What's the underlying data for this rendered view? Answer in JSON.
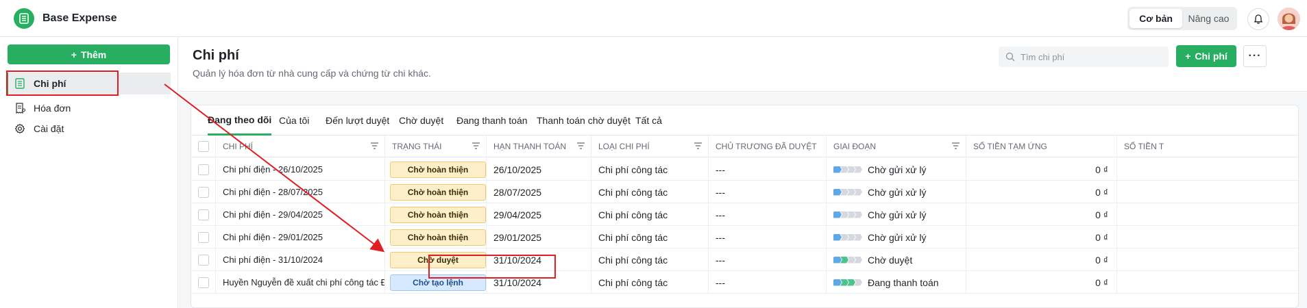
{
  "app": {
    "title": "Base Expense"
  },
  "header": {
    "mode_basic": "Cơ bản",
    "mode_advanced": "Nâng cao"
  },
  "sidebar": {
    "add_label": "Thêm",
    "items": [
      {
        "label": "Chi phí"
      },
      {
        "label": "Hóa đơn"
      },
      {
        "label": "Cài đặt"
      }
    ]
  },
  "page": {
    "title": "Chi phí",
    "subtitle": "Quản lý hóa đơn từ nhà cung cấp và chứng từ chi khác.",
    "search_placeholder": "Tìm chi phí",
    "add_button": "Chi phí",
    "more_button": "···"
  },
  "tabs": [
    {
      "label": "Đang theo dõi"
    },
    {
      "label": "Của tôi"
    },
    {
      "label": "Đến lượt duyệt"
    },
    {
      "label": "Chờ duyệt"
    },
    {
      "label": "Đang thanh toán"
    },
    {
      "label": "Thanh toán chờ duyệt"
    },
    {
      "label": "Tất cả"
    }
  ],
  "columns": {
    "name": "Chi phí",
    "status": "Trạng thái",
    "due": "Hạn thanh toán",
    "type": "Loại chi phí",
    "policy": "Chủ trương đã duyệt",
    "stage": "Giai đoạn",
    "advance": "Số tiền tạm ứng",
    "amount": "Số tiền t"
  },
  "rows": [
    {
      "name": "Chi phí điện - 26/10/2025",
      "status": "Chờ hoàn thiện",
      "due": "26/10/2025",
      "type": "Chi phí công tác",
      "policy": "---",
      "stage": "Chờ gửi xử lý",
      "advance": "0 ₫"
    },
    {
      "name": "Chi phí điện - 28/07/2025",
      "status": "Chờ hoàn thiện",
      "due": "28/07/2025",
      "type": "Chi phí công tác",
      "policy": "---",
      "stage": "Chờ gửi xử lý",
      "advance": "0 ₫"
    },
    {
      "name": "Chi phí điện - 29/04/2025",
      "status": "Chờ hoàn thiện",
      "due": "29/04/2025",
      "type": "Chi phí công tác",
      "policy": "---",
      "stage": "Chờ gửi xử lý",
      "advance": "0 ₫"
    },
    {
      "name": "Chi phí điện - 29/01/2025",
      "status": "Chờ hoàn thiện",
      "due": "29/01/2025",
      "type": "Chi phí công tác",
      "policy": "---",
      "stage": "Chờ gửi xử lý",
      "advance": "0 ₫"
    },
    {
      "name": "Chi phí điện - 31/10/2024",
      "status": "Chờ duyệt",
      "due": "31/10/2024",
      "type": "Chi phí công tác",
      "policy": "---",
      "stage": "Chờ duyệt",
      "advance": "0 ₫"
    },
    {
      "name": "Huyền Nguyễn đề xuất chi phí công tác Đà Nẵng",
      "status": "Chờ tạo lệnh",
      "due": "31/10/2024",
      "type": "Chi phí công tác",
      "policy": "---",
      "stage": "Đang thanh toán",
      "advance": "0 ₫"
    }
  ],
  "colors": {
    "accent": "#27ae60",
    "annotation": "#e11d21",
    "pending_badge": "#fdefc9",
    "order_badge": "#d6e9ff"
  }
}
